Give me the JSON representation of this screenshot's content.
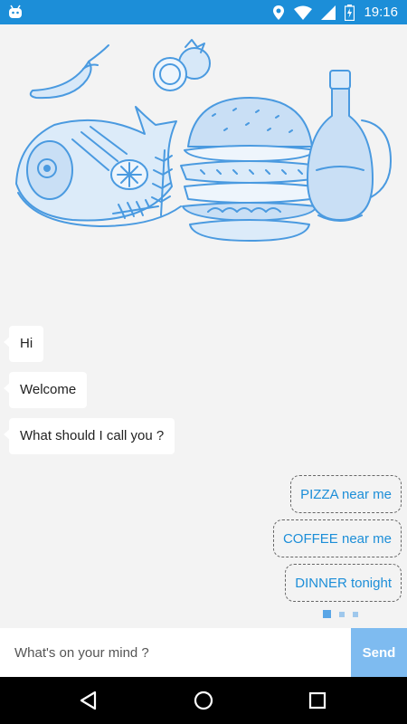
{
  "status_bar": {
    "time": "19:16",
    "icons": [
      "android-debug-icon",
      "location-icon",
      "wifi-icon",
      "signal-icon",
      "battery-charging-icon"
    ],
    "background": "#1c8ed8"
  },
  "illustration": {
    "subject": "food-sketch",
    "items": [
      "chili-pepper",
      "tomato",
      "fish",
      "lemon",
      "herb",
      "burger",
      "oil-bottle"
    ],
    "stroke_color": "#4a9ae0",
    "fill_color": "#c9dff5"
  },
  "chat": {
    "messages": [
      {
        "text": "Hi"
      },
      {
        "text": "Welcome"
      },
      {
        "text": "What should I call you ?"
      }
    ]
  },
  "suggestions": [
    {
      "label": "PIZZA near me"
    },
    {
      "label": "COFFEE near me"
    },
    {
      "label": "DINNER tonight"
    }
  ],
  "pager": {
    "count": 3,
    "active_index": 0
  },
  "input": {
    "placeholder": "What's on your mind ?",
    "value": ""
  },
  "send_button": {
    "label": "Send",
    "background": "#7ebbf0"
  },
  "navigation": {
    "buttons": [
      "back-icon",
      "home-icon",
      "recents-icon"
    ]
  }
}
